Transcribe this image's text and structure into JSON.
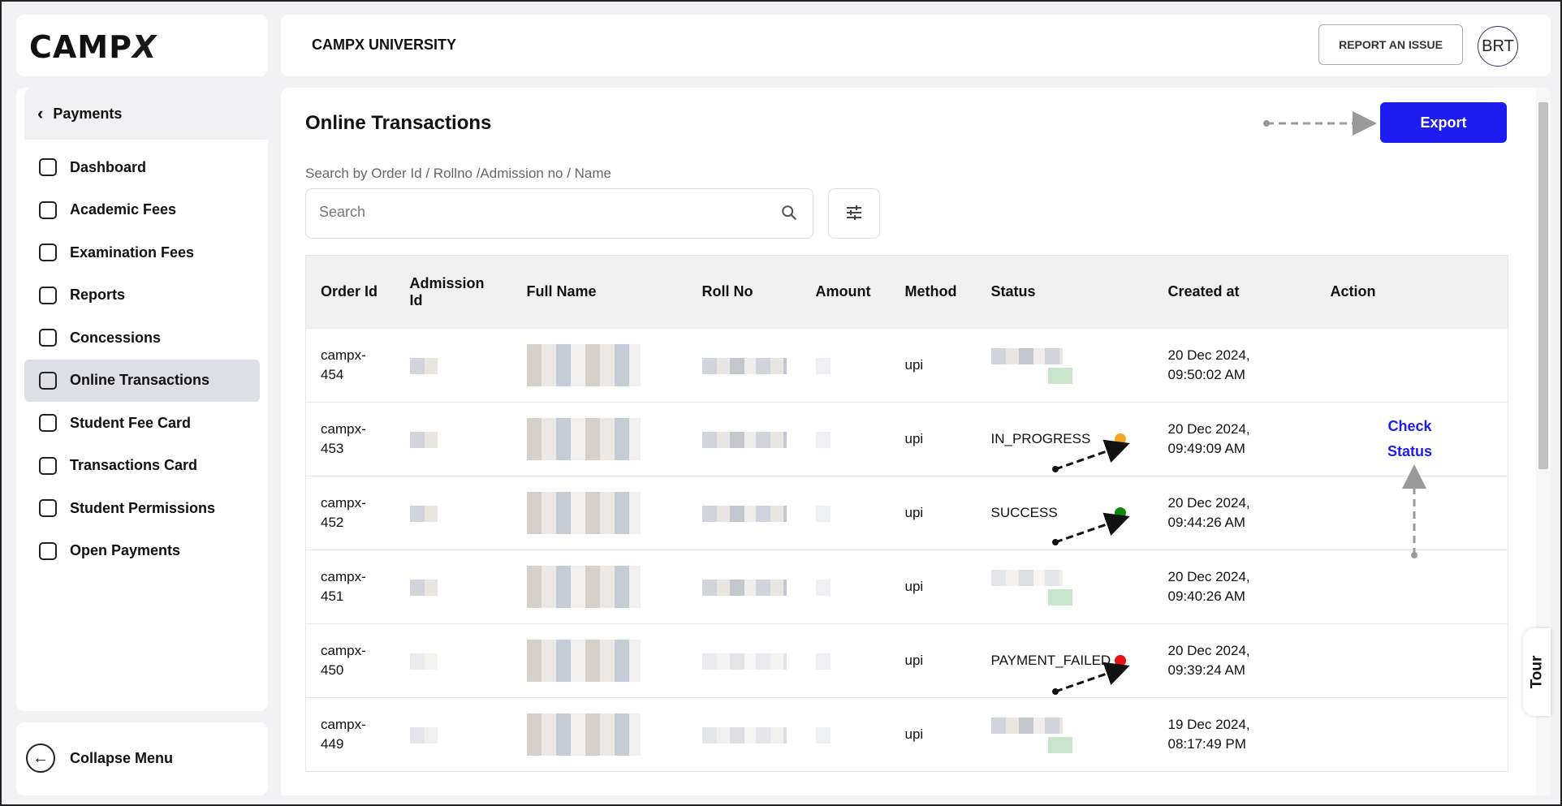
{
  "app": {
    "logo": "CAMPX",
    "university": "CAMPX UNIVERSITY"
  },
  "header": {
    "report_label": "REPORT AN ISSUE",
    "avatar_text": "BRT"
  },
  "sidebar": {
    "back_label": "Payments",
    "items": [
      {
        "label": "Dashboard",
        "icon": "dashboard-icon"
      },
      {
        "label": "Academic Fees",
        "icon": "academic-cap-icon"
      },
      {
        "label": "Examination Fees",
        "icon": "exam-icon"
      },
      {
        "label": "Reports",
        "icon": "report-icon"
      },
      {
        "label": "Concessions",
        "icon": "concession-icon"
      },
      {
        "label": "Online Transactions",
        "icon": "cast-icon",
        "active": true
      },
      {
        "label": "Student Fee Card",
        "icon": "id-card-icon"
      },
      {
        "label": "Transactions Card",
        "icon": "transaction-card-icon"
      },
      {
        "label": "Student Permissions",
        "icon": "user-permission-icon"
      },
      {
        "label": "Open Payments",
        "icon": "wallet-icon"
      }
    ],
    "collapse_label": "Collapse Menu"
  },
  "main": {
    "title": "Online Transactions",
    "export_label": "Export",
    "search_label": "Search by Order Id / Rollno /Admission no / Name",
    "search_placeholder": "Search",
    "columns": [
      "Order Id",
      "Admission Id",
      "Full Name",
      "Roll No",
      "Amount",
      "Method",
      "Status",
      "Created at",
      "Action"
    ],
    "rows": [
      {
        "order_id": "campx-454",
        "method": "upi",
        "status": "",
        "created": "20 Dec 2024, 09:50:02 AM",
        "action": ""
      },
      {
        "order_id": "campx-453",
        "method": "upi",
        "status": "IN_PROGRESS",
        "created": "20 Dec 2024, 09:49:09 AM",
        "action": "Check Status"
      },
      {
        "order_id": "campx-452",
        "method": "upi",
        "status": "SUCCESS",
        "created": "20 Dec 2024, 09:44:26 AM",
        "action": ""
      },
      {
        "order_id": "campx-451",
        "method": "upi",
        "status": "",
        "created": "20 Dec 2024, 09:40:26 AM",
        "action": ""
      },
      {
        "order_id": "campx-450",
        "method": "upi",
        "status": "PAYMENT_FAILED",
        "created": "20 Dec 2024, 09:39:24 AM",
        "action": ""
      },
      {
        "order_id": "campx-449",
        "method": "upi",
        "status": "",
        "created": "19 Dec 2024, 08:17:49 PM",
        "action": ""
      }
    ],
    "tour_label": "Tour"
  },
  "colors": {
    "accent": "#1d1df0",
    "in_progress": "#f5a623",
    "success": "#0a8a0a",
    "failed": "#e81010"
  }
}
